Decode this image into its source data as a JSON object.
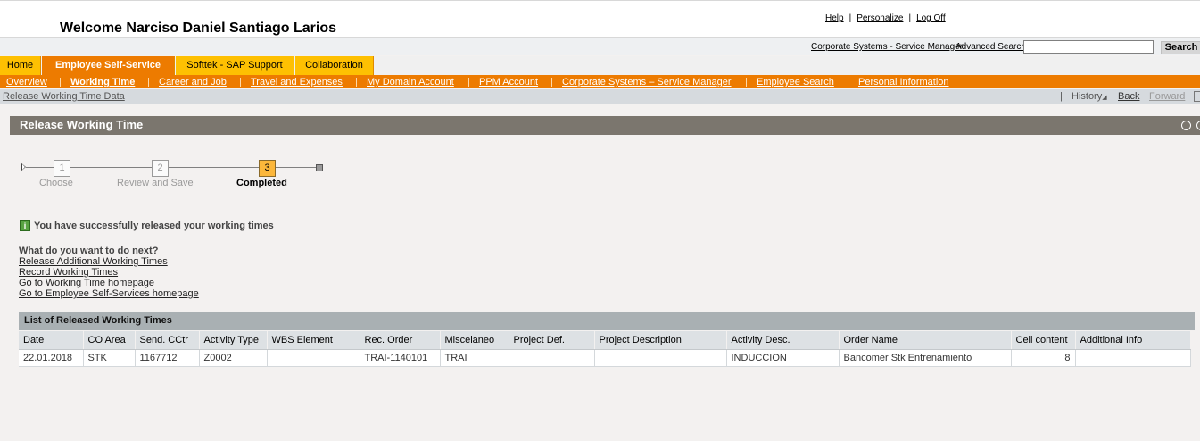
{
  "header": {
    "welcome": "Welcome Narciso Daniel Santiago Larios",
    "links": [
      "Help",
      "Personalize",
      "Log Off"
    ],
    "separator": "|"
  },
  "searchbar": {
    "service_manager_link": "Corporate Systems - Service Manager",
    "advanced_search_link": "Advanced Search",
    "search_value": "",
    "search_button": "Search"
  },
  "tabs": [
    {
      "label": "Home",
      "active": false
    },
    {
      "label": "Employee Self-Service",
      "active": true
    },
    {
      "label": "Softtek - SAP Support",
      "active": false
    },
    {
      "label": "Collaboration",
      "active": false
    }
  ],
  "subnav": [
    {
      "label": "Overview",
      "active": false
    },
    {
      "label": "Working Time",
      "active": true
    },
    {
      "label": "Career and Job",
      "active": false
    },
    {
      "label": "Travel and Expenses",
      "active": false
    },
    {
      "label": "My Domain Account",
      "active": false
    },
    {
      "label": "PPM Account",
      "active": false
    },
    {
      "label": "Corporate Systems – Service Manager",
      "active": false
    },
    {
      "label": "Employee Search",
      "active": false
    },
    {
      "label": "Personal Information",
      "active": false
    }
  ],
  "content_nav": {
    "breadcrumb": "Release Working Time Data",
    "history": "History",
    "back": "Back",
    "forward": "Forward"
  },
  "page": {
    "title": "Release Working Time"
  },
  "roadmap": {
    "steps": [
      {
        "number": "1",
        "label": "Choose",
        "current": false
      },
      {
        "number": "2",
        "label": "Review and Save",
        "current": false
      },
      {
        "number": "3",
        "label": "Completed",
        "current": true
      }
    ]
  },
  "message": {
    "icon": "i",
    "text": "You have successfully released your working times"
  },
  "next_steps": {
    "question": "What do you want to do next?",
    "links": [
      "Release Additional Working Times",
      "Record Working Times",
      "Go to Working Time homepage",
      "Go to Employee Self-Services homepage"
    ]
  },
  "table": {
    "title": "List of Released Working Times",
    "columns": [
      "Date",
      "CO Area",
      "Send. CCtr",
      "Activity Type",
      "WBS Element",
      "Rec. Order",
      "Miscelaneo",
      "Project Def.",
      "Project Description",
      "Activity Desc.",
      "Order Name",
      "Cell content",
      "Additional Info"
    ],
    "rows": [
      [
        "22.01.2018",
        "STK",
        "1167712",
        "Z0002",
        "",
        "TRAI-1140101",
        "TRAI",
        "",
        "",
        "INDUCCION",
        "Bancomer Stk Entrenamiento",
        "8",
        ""
      ]
    ]
  },
  "colors": {
    "tab_yellow": "#fec002",
    "tab_orange": "#ed7b00",
    "title_bar": "#7b766e",
    "current_step": "#fcb73b",
    "success_icon": "#58a342"
  }
}
